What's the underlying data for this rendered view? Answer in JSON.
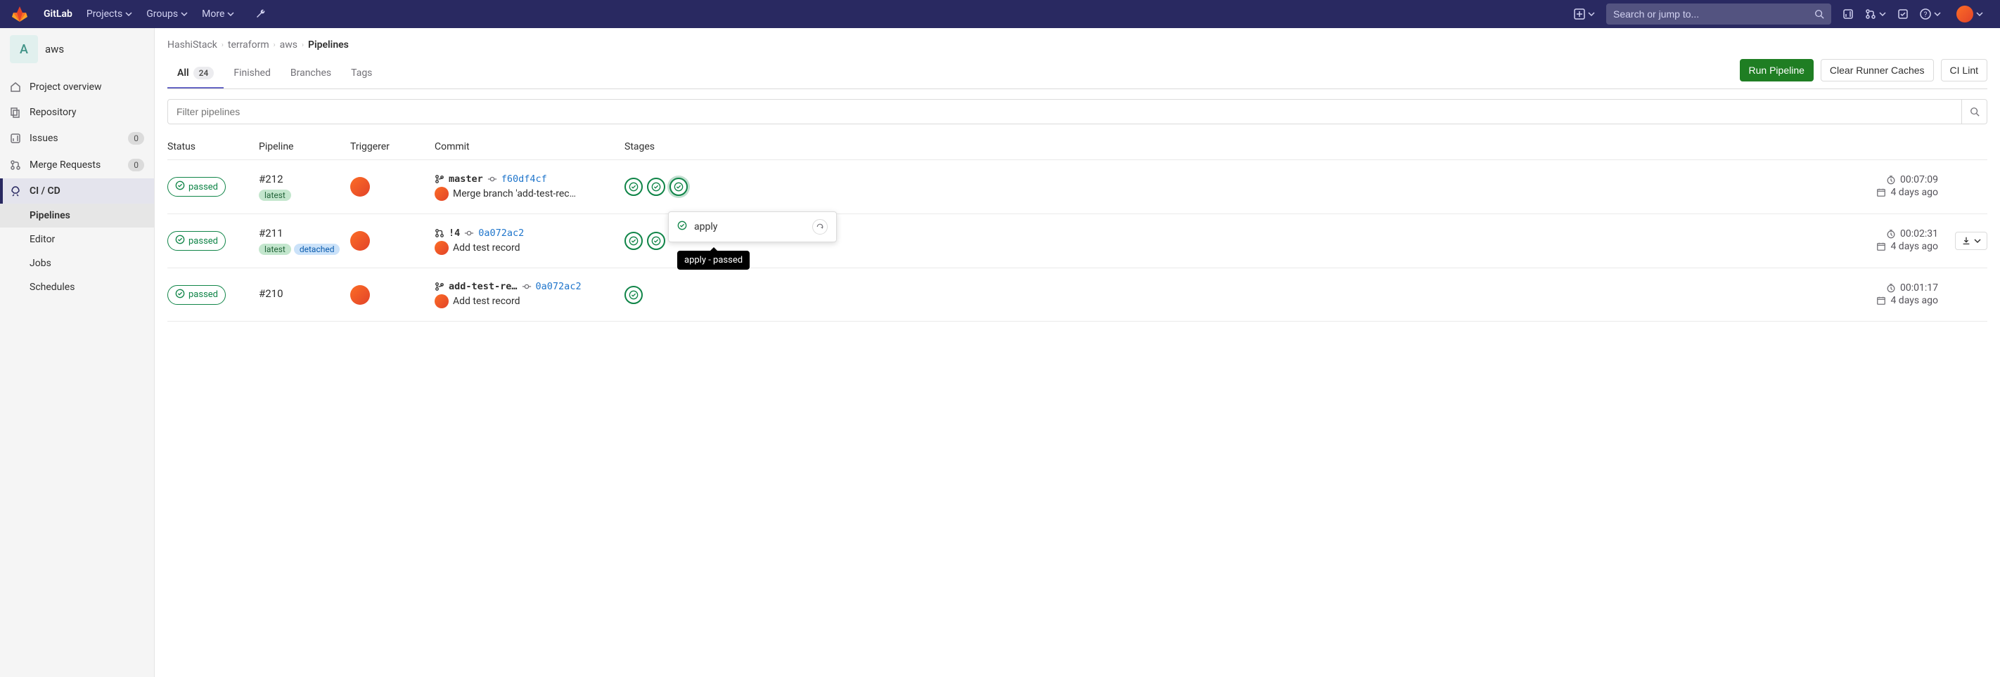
{
  "navbar": {
    "brand": "GitLab",
    "items": [
      "Projects",
      "Groups",
      "More"
    ],
    "search_placeholder": "Search or jump to..."
  },
  "sidebar": {
    "project_initial": "A",
    "project_name": "aws",
    "items": [
      {
        "label": "Project overview",
        "icon": "home"
      },
      {
        "label": "Repository",
        "icon": "files"
      },
      {
        "label": "Issues",
        "icon": "issues",
        "badge": "0"
      },
      {
        "label": "Merge Requests",
        "icon": "merge",
        "badge": "0"
      },
      {
        "label": "CI / CD",
        "icon": "rocket",
        "active": true
      }
    ],
    "submenu": [
      {
        "label": "Pipelines",
        "active": true
      },
      {
        "label": "Editor"
      },
      {
        "label": "Jobs"
      },
      {
        "label": "Schedules"
      }
    ]
  },
  "breadcrumb": [
    "HashiStack",
    "terraform",
    "aws",
    "Pipelines"
  ],
  "tabs": [
    {
      "label": "All",
      "count": "24",
      "active": true
    },
    {
      "label": "Finished"
    },
    {
      "label": "Branches"
    },
    {
      "label": "Tags"
    }
  ],
  "buttons": {
    "run": "Run Pipeline",
    "clear": "Clear Runner Caches",
    "lint": "CI Lint"
  },
  "filter_placeholder": "Filter pipelines",
  "columns": {
    "status": "Status",
    "pipeline": "Pipeline",
    "triggerer": "Triggerer",
    "commit": "Commit",
    "stages": "Stages"
  },
  "pipelines": [
    {
      "status": "passed",
      "id": "#212",
      "labels": [
        "latest"
      ],
      "ref_type": "branch",
      "ref": "master",
      "sha": "f60df4cf",
      "message": "Merge branch 'add-test-rec…",
      "stages": 3,
      "highlight_stage": 2,
      "duration": "00:07:09",
      "finished": "4 days ago",
      "download": false,
      "popover": true
    },
    {
      "status": "passed",
      "id": "#211",
      "labels": [
        "latest",
        "detached"
      ],
      "ref_type": "mr",
      "ref": "4",
      "sha": "0a072ac2",
      "message": "Add test record",
      "stages": 2,
      "duration": "00:02:31",
      "finished": "4 days ago",
      "download": true
    },
    {
      "status": "passed",
      "id": "#210",
      "labels": [],
      "ref_type": "branch",
      "ref": "add-test-re…",
      "sha": "0a072ac2",
      "message": "Add test record",
      "stages": 1,
      "duration": "00:01:17",
      "finished": "4 days ago",
      "download": false
    }
  ],
  "popover": {
    "job": "apply",
    "tooltip": "apply - passed"
  }
}
